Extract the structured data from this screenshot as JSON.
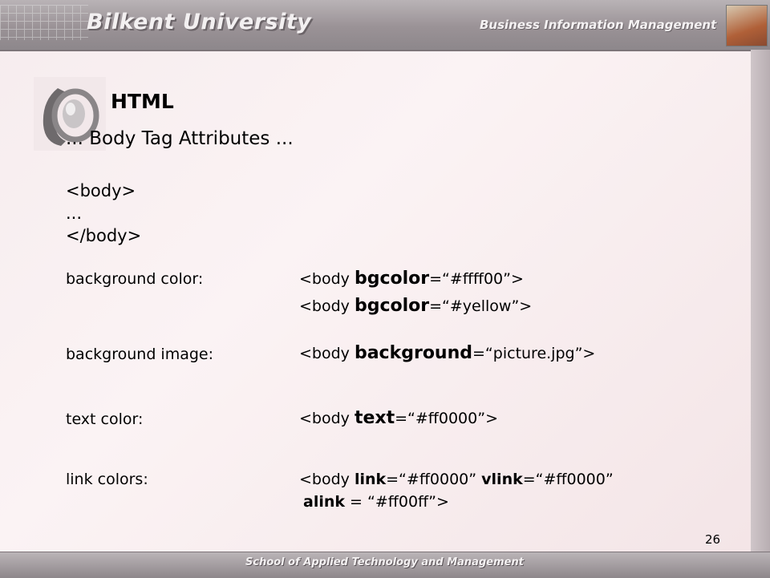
{
  "header": {
    "university": "Bilkent University",
    "department": "Business Information Management"
  },
  "footer": {
    "school": "School of Applied Technology and Management"
  },
  "slide": {
    "title": "HTML",
    "subtitle": "... Body Tag Attributes ...",
    "code_lines": [
      "<body>",
      "...",
      "</body>"
    ],
    "page_number": "26"
  },
  "attributes": {
    "bg_color": {
      "label": "background color:",
      "line1": {
        "pre": "<body ",
        "attr": "bgcolor",
        "post": "=“#ffff00”>"
      },
      "line2": {
        "pre": "<body ",
        "attr": "bgcolor",
        "post": "=“#yellow”>"
      }
    },
    "bg_image": {
      "label": "background image:",
      "line1": {
        "pre": "<body ",
        "attr": "background",
        "post": "=“picture.jpg”>"
      }
    },
    "text_color": {
      "label": "text color:",
      "line1": {
        "pre": "<body ",
        "attr": "text",
        "post": "=“#ff0000”>"
      }
    },
    "link_colors": {
      "label": "link colors:",
      "pre": "<body ",
      "link_attr": "link",
      "link_val": "=“#ff0000” ",
      "vlink_attr": "vlink",
      "vlink_val": "=“#ff0000”",
      "alink_attr": "alink",
      "alink_val": " = “#ff00ff”>"
    }
  }
}
